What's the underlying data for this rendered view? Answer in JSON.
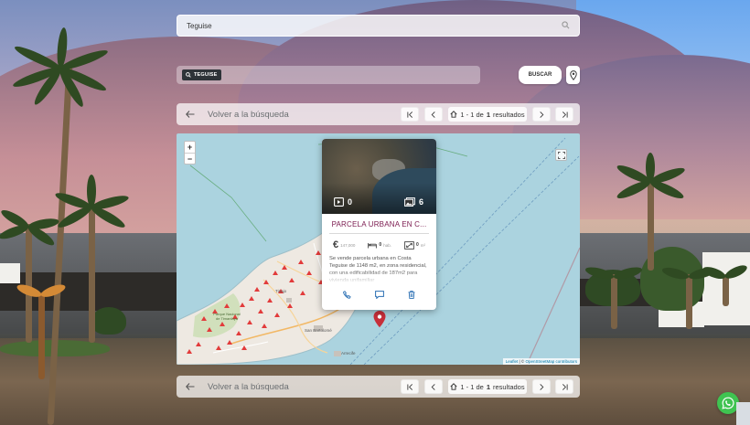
{
  "search": {
    "value": "Teguise",
    "search_icon": "search-icon"
  },
  "filters": {
    "chip_label": "TEGUISE",
    "buscar_label": "BUSCAR",
    "location_icon": "map-pin-icon"
  },
  "navigation": {
    "back_label": "Volver a la búsqueda",
    "results_prefix": "1 - 1 de",
    "results_count": "1",
    "results_suffix": "resultados"
  },
  "map": {
    "zoom_in": "+",
    "zoom_out": "−",
    "attribution_leaflet": "Leaflet",
    "attribution_sep": " | © ",
    "attribution_osm": "OpenStreetMap contributors",
    "labels": {
      "timanfaya": "Parque Nacional de Timanfaya",
      "tinajo": "Tinajo",
      "san_bartolome": "San Bartolomé",
      "arrecife": "Arrecife"
    }
  },
  "property": {
    "title": "PARCELA URBANA EN C...",
    "video_count": "0",
    "photo_count": "6",
    "price": "147,000",
    "bedrooms": "0",
    "bedrooms_unit": "hab.",
    "area": "0",
    "area_unit": "m²",
    "description": "Se vende parcela urbana en Costa Teguise de 1148 m2, en zona residencial, con una edificabilidad de 187m2 para vivienda unifamiliar"
  },
  "colors": {
    "accent_title": "#7b1a4f",
    "action_blue": "#2a6fb3",
    "map_sea": "#abd3df",
    "whatsapp": "#3fc351"
  }
}
